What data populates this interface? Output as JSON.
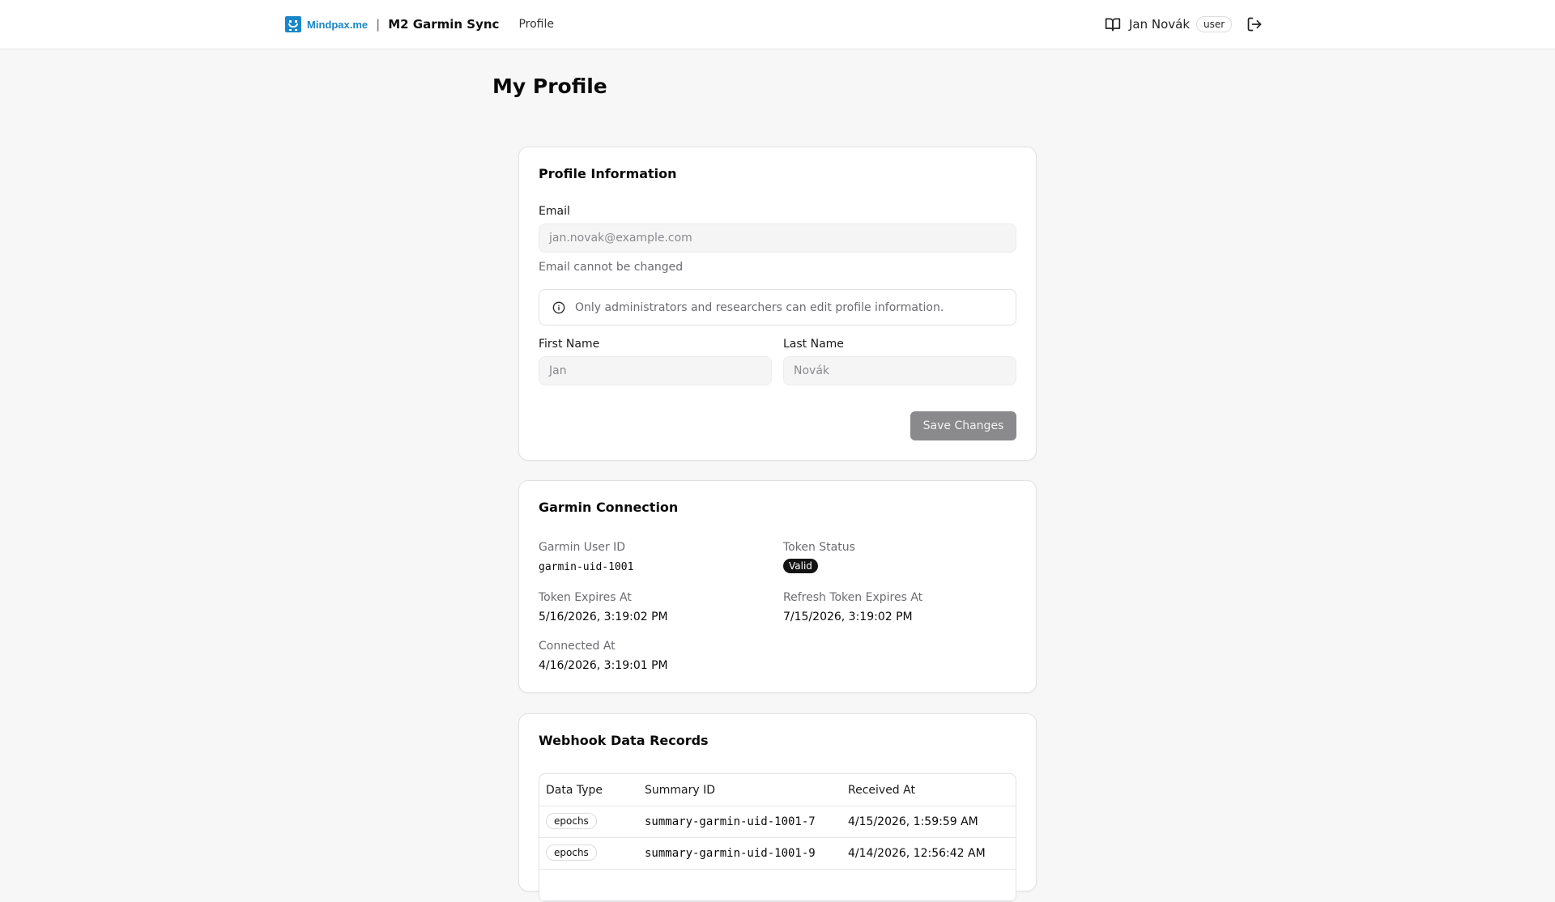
{
  "header": {
    "logo_text": "Mindpax.me",
    "separator": "|",
    "app_title": "M2 Garmin Sync",
    "nav_profile": "Profile",
    "user_name": "Jan Novák",
    "user_role": "user"
  },
  "page": {
    "title": "My Profile"
  },
  "profile_card": {
    "title": "Profile Information",
    "email_label": "Email",
    "email_value": "jan.novak@example.com",
    "email_hint": "Email cannot be changed",
    "alert_text": "Only administrators and researchers can edit profile information.",
    "first_name_label": "First Name",
    "first_name_value": "Jan",
    "last_name_label": "Last Name",
    "last_name_value": "Novák",
    "save_label": "Save Changes"
  },
  "garmin_card": {
    "title": "Garmin Connection",
    "user_id_label": "Garmin User ID",
    "user_id_value": "garmin-uid-1001",
    "token_status_label": "Token Status",
    "token_status_value": "Valid",
    "token_expires_label": "Token Expires At",
    "token_expires_value": "5/16/2026, 3:19:02 PM",
    "refresh_expires_label": "Refresh Token Expires At",
    "refresh_expires_value": "7/15/2026, 3:19:02 PM",
    "connected_label": "Connected At",
    "connected_value": "4/16/2026, 3:19:01 PM"
  },
  "webhook_card": {
    "title": "Webhook Data Records",
    "columns": [
      "Data Type",
      "Summary ID",
      "Received At"
    ],
    "rows": [
      {
        "type": "epochs",
        "summary_id": "summary-garmin-uid-1001-7",
        "received_at": "4/15/2026, 1:59:59 AM"
      },
      {
        "type": "epochs",
        "summary_id": "summary-garmin-uid-1001-9",
        "received_at": "4/14/2026, 12:56:42 AM"
      }
    ]
  },
  "colors": {
    "brand": "#1a86c9",
    "badge_dark": "#141414",
    "button_disabled": "#8a8a8d"
  },
  "icons": [
    "logo-icon",
    "book-icon",
    "logout-icon",
    "info-icon"
  ]
}
